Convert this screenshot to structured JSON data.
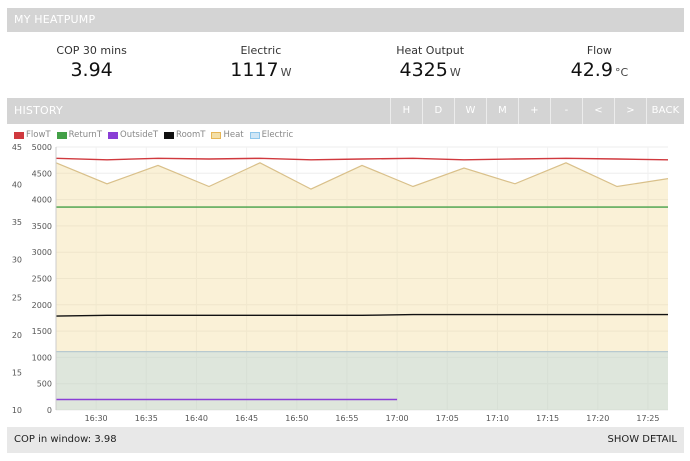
{
  "panel": {
    "title": "MY HEATPUMP"
  },
  "stats": [
    {
      "label": "COP 30 mins",
      "value": "3.94",
      "unit": ""
    },
    {
      "label": "Electric",
      "value": "1117",
      "unit": "W"
    },
    {
      "label": "Heat Output",
      "value": "4325",
      "unit": "W"
    },
    {
      "label": "Flow",
      "value": "42.9",
      "unit": "°C"
    }
  ],
  "history": {
    "title": "HISTORY",
    "buttons": [
      "H",
      "D",
      "W",
      "M",
      "+",
      "-",
      "<",
      ">",
      "BACK"
    ]
  },
  "legend": [
    {
      "name": "FlowT",
      "color": "#d0393e"
    },
    {
      "name": "ReturnT",
      "color": "#43a047"
    },
    {
      "name": "OutsideT",
      "color": "#8a3fd6"
    },
    {
      "name": "RoomT",
      "color": "#111111"
    },
    {
      "name": "Heat",
      "color": "#e6b657"
    },
    {
      "name": "Electric",
      "color": "#8ec7ec"
    }
  ],
  "chart_data": {
    "type": "line",
    "x_ticks": [
      "16:30",
      "16:35",
      "16:40",
      "16:45",
      "16:50",
      "16:55",
      "17:00",
      "17:05",
      "17:10",
      "17:15",
      "17:20",
      "17:25"
    ],
    "x_range": [
      "16:26",
      "17:27"
    ],
    "y_left_ticks": [
      10,
      15,
      20,
      25,
      30,
      35,
      40,
      45
    ],
    "y_left_range": [
      10,
      45
    ],
    "y_right_ticks": [
      0,
      500,
      1000,
      1500,
      2000,
      2500,
      3000,
      3500,
      4000,
      4500,
      5000
    ],
    "y_right_range": [
      0,
      5000
    ],
    "series": [
      {
        "name": "FlowT",
        "axis": "left",
        "values": [
          43.5,
          43.3,
          43.5,
          43.4,
          43.5,
          43.3,
          43.4,
          43.5,
          43.3,
          43.4,
          43.5,
          43.4,
          43.3
        ]
      },
      {
        "name": "ReturnT",
        "axis": "left",
        "values": [
          37.0,
          37.0,
          37.0,
          37.0,
          37.0,
          37.0,
          37.0,
          37.0,
          37.0,
          37.0,
          37.0,
          37.0,
          37.0
        ]
      },
      {
        "name": "OutsideT",
        "axis": "left",
        "end": "17:00",
        "values": [
          11.4,
          11.4,
          11.4,
          11.4,
          11.4,
          11.4,
          11.4
        ]
      },
      {
        "name": "RoomT",
        "axis": "left",
        "values": [
          22.5,
          22.6,
          22.6,
          22.6,
          22.6,
          22.6,
          22.6,
          22.7,
          22.7,
          22.7,
          22.7,
          22.7,
          22.7
        ]
      },
      {
        "name": "Heat",
        "axis": "right",
        "values": [
          4700,
          4300,
          4650,
          4250,
          4700,
          4200,
          4650,
          4250,
          4600,
          4300,
          4700,
          4250,
          4400
        ]
      },
      {
        "name": "Electric",
        "axis": "right",
        "values": [
          1110,
          1110,
          1110,
          1110,
          1110,
          1110,
          1110,
          1110,
          1110,
          1110,
          1110,
          1110,
          1110
        ]
      }
    ]
  },
  "footer": {
    "cop_label": "COP in window:",
    "cop_value": "3.98",
    "show_detail": "SHOW DETAIL"
  }
}
